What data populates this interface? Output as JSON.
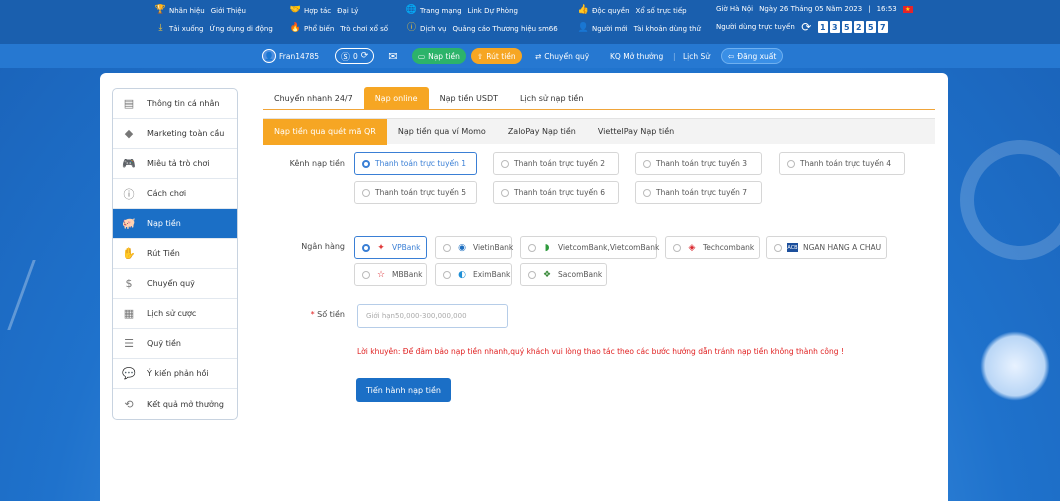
{
  "topbar": {
    "row1": [
      {
        "icon": "trophy-icon",
        "label": "Nhãn hiệu",
        "link": "Giới Thiệu"
      },
      {
        "icon": "handshake-icon",
        "label": "Hợp tác",
        "link": "Đại Lý"
      },
      {
        "icon": "globe-icon",
        "label": "Trang mạng",
        "link": "Link Dự Phòng"
      },
      {
        "icon": "thumbs-up-icon",
        "label": "Độc quyền",
        "link": "Xổ số trực tiếp"
      }
    ],
    "row2": [
      {
        "icon": "download-icon",
        "label": "Tải xuống",
        "link": "Ứng dụng di động"
      },
      {
        "icon": "fire-icon",
        "label": "Phổ biến",
        "link": "Trò chơi xổ số"
      },
      {
        "icon": "info-icon",
        "label": "Dịch vụ",
        "link": "Quảng cáo Thương hiệu sm66"
      },
      {
        "icon": "user-icon",
        "label": "Người mới",
        "link": "Tài khoản dùng thử"
      }
    ],
    "time_label": "Giờ Hà Nội",
    "time_value": "Ngày 26 Tháng 05 Năm 2023",
    "time_sep": "|",
    "time_clock": "16:53",
    "online_label": "Người dùng trực tuyến",
    "online_digits": [
      "1",
      "3",
      "5",
      "2",
      "5",
      "7"
    ]
  },
  "userbar": {
    "username": "Fran14785",
    "balance": "0",
    "deposit": "Nạp tiền",
    "withdraw": "Rút tiền",
    "transfer": "Chuyển quỹ",
    "results": "KQ Mở thưởng",
    "history": "Lịch Sử",
    "logout": "Đăng xuất"
  },
  "sidebar": {
    "items": [
      {
        "label": "Thông tin cá nhân",
        "icon": "id-card-icon"
      },
      {
        "label": "Marketing toàn cầu",
        "icon": "diamond-icon"
      },
      {
        "label": "Miêu tả trò chơi",
        "icon": "gamepad-icon"
      },
      {
        "label": "Cách chơi",
        "icon": "info-circle-icon"
      },
      {
        "label": "Nạp tiền",
        "icon": "piggy-bank-icon",
        "active": true
      },
      {
        "label": "Rút Tiền",
        "icon": "money-hand-icon"
      },
      {
        "label": "Chuyển quỹ",
        "icon": "dollar-circle-icon"
      },
      {
        "label": "Lịch sử cược",
        "icon": "receipt-icon"
      },
      {
        "label": "Quỹ tiền",
        "icon": "fund-icon"
      },
      {
        "label": "Ý kiến phản hồi",
        "icon": "chat-bubble-icon"
      },
      {
        "label": "Kết quả mở thưởng",
        "icon": "history-icon"
      }
    ]
  },
  "tabs_primary": [
    "Chuyển nhanh 24/7",
    "Nạp online",
    "Nạp tiền USDT",
    "Lịch sử nạp tiền"
  ],
  "tabs_primary_active": 1,
  "tabs_secondary": [
    "Nạp tiền qua quét mã QR",
    "Nạp tiền qua ví Momo",
    "ZaloPay Nạp tiền",
    "ViettelPay Nạp tiền"
  ],
  "tabs_secondary_active": 0,
  "form": {
    "channel_label": "Kênh nạp tiền",
    "channels": [
      "Thanh toán trực tuyến 1",
      "Thanh toán trực tuyến 2",
      "Thanh toán trực tuyến 3",
      "Thanh toán trực tuyến 4",
      "Thanh toán trực tuyến 5",
      "Thanh toán trực tuyến 6",
      "Thanh toán trực tuyến 7"
    ],
    "bank_label": "Ngân hàng",
    "banks": [
      "VPBank",
      "VietinBank",
      "VietcomBank,VietcomBank",
      "Techcombank",
      "NGAN HANG A CHAU",
      "MBBank",
      "EximBank",
      "SacomBank"
    ],
    "bank_colors": [
      "#e03a3a",
      "#1e6fc0",
      "#2e9a3c",
      "#d9252c",
      "#1c4f9c",
      "#d9252c",
      "#1e8fd6",
      "#3a8a3a"
    ],
    "amount_required": "*",
    "amount_label": "Số tiền",
    "amount_placeholder": "Giới hạn50,000-300,000,000",
    "note": "Lời khuyên:  Để đảm bảo nạp tiền nhanh,quý khách vui lòng thao tác theo các bước hướng dẫn tránh nạp tiền không thành công !",
    "submit": "Tiến hành nạp tiền"
  }
}
